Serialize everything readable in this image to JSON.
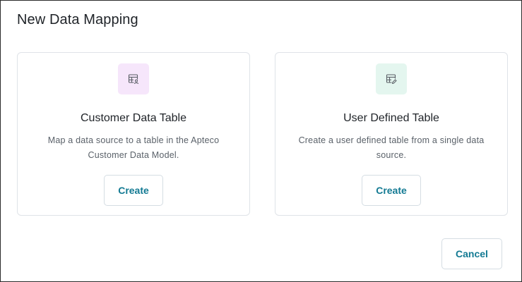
{
  "dialog": {
    "title": "New Data Mapping",
    "cancel_label": "Cancel"
  },
  "options": [
    {
      "icon": "table-person-icon",
      "title": "Customer Data Table",
      "description": "Map a data source to a table in the Apteco Customer Data Model.",
      "button_label": "Create"
    },
    {
      "icon": "table-edit-icon",
      "title": "User Defined Table",
      "description": "Create a user defined table from a single data source.",
      "button_label": "Create"
    }
  ],
  "colors": {
    "accent": "#137a93",
    "pink_tile": "#f6e6fb",
    "mint_tile": "#e4f6ef"
  }
}
